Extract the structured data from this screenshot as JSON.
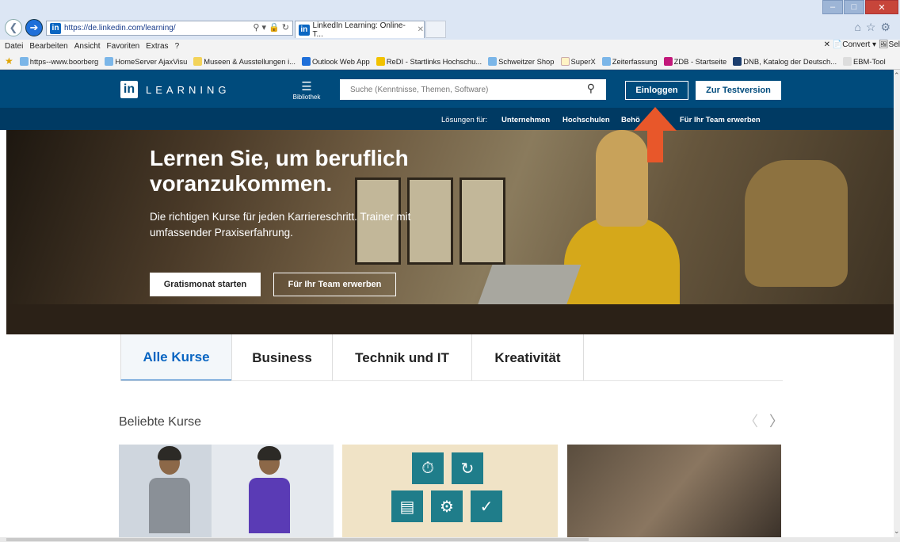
{
  "browser": {
    "url": "https://de.linkedin.com/learning/",
    "tab_title": "LinkedIn Learning: Online-T...",
    "menu": [
      "Datei",
      "Bearbeiten",
      "Ansicht",
      "Favoriten",
      "Extras",
      "?"
    ],
    "menu_right": "✕ 📄Convert ▾ 🖼Sel",
    "favorites": [
      "https--www.boorberg",
      "HomeServer AjaxVisu",
      "Museen & Ausstellungen i...",
      "Outlook Web App",
      "ReDI - Startlinks Hochschu...",
      "Schweitzer Shop",
      "SuperX",
      "Zeiterfassung",
      "ZDB - Startseite",
      "DNB, Katalog der Deutsch...",
      "EBM-Tool"
    ]
  },
  "header": {
    "logo_in": "in",
    "logo_word": "LEARNING",
    "library_label": "Bibliothek",
    "search_placeholder": "Suche (Kenntnisse, Themen, Software)",
    "login": "Einloggen",
    "trial": "Zur Testversion"
  },
  "subnav": {
    "label": "Lösungen für:",
    "items": [
      "Unternehmen",
      "Hochschulen",
      "Behö",
      "Für Ihr Team erwerben"
    ]
  },
  "hero": {
    "title": "Lernen Sie, um beruflich voranzukommen.",
    "text": "Die richtigen Kurse für jeden Karriereschritt. Trainer mit umfassender Praxiserfahrung.",
    "btn_primary": "Gratismonat starten",
    "btn_secondary": "Für Ihr Team erwerben"
  },
  "tabs": [
    "Alle Kurse",
    "Business",
    "Technik und IT",
    "Kreativität"
  ],
  "section": {
    "title": "Beliebte Kurse",
    "prev": "〈",
    "next": "〉"
  },
  "colors": {
    "brand": "#004b7c",
    "accent": "#0a66c2",
    "arrow": "#e8572a"
  }
}
